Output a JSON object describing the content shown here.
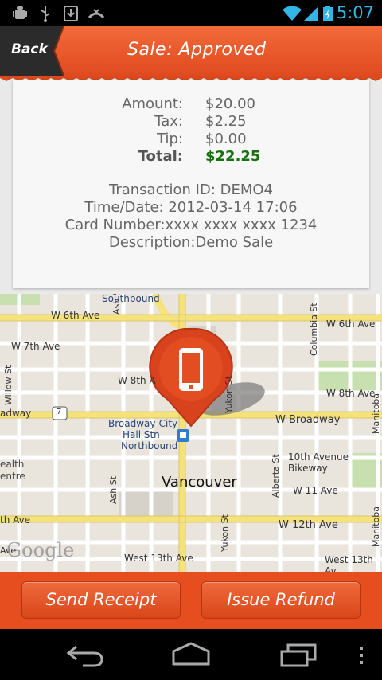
{
  "status_bar": {
    "time": "5:07",
    "icons": [
      "android-debug-icon",
      "usb-icon",
      "download-icon",
      "voicemail-icon",
      "wifi-icon",
      "signal-icon",
      "battery-charging-icon"
    ]
  },
  "header": {
    "back_label": "Back",
    "title": "Sale: Approved"
  },
  "receipt": {
    "amount_label": "Amount:",
    "amount_value": "$20.00",
    "tax_label": "Tax:",
    "tax_value": "$2.25",
    "tip_label": "Tip:",
    "tip_value": "$0.00",
    "total_label": "Total:",
    "total_value": "$22.25",
    "transaction_id": "Transaction ID: DEMO4",
    "time_date": "Time/Date: 2012-03-14 17:06",
    "card_number": "Card Number:xxxx xxxx xxxx 1234",
    "description": "Description:Demo Sale"
  },
  "map": {
    "city_label": "Vancouver",
    "attribution": "Google",
    "streets": [
      "Southbound",
      "W 6th Ave",
      "W 7th Ave",
      "W 8th A",
      "W 6th Ave",
      "W 8th Ave",
      "adway",
      "W Broadway",
      "10th Avenue Bikeway",
      "W 11 Ave",
      "W 12th Ave",
      "th Ave",
      "West 13th Ave",
      "West 13th Av",
      "Ash St",
      "Ash St",
      "Willow St",
      "Yukon St",
      "Yukon St",
      "Columbia St",
      "Alberta St",
      "Manitoba St",
      "Manitoba St",
      "Ave"
    ],
    "station_label_1": "Broadway-City",
    "station_label_2": "Hall Stn",
    "station_label_3": "Northbound",
    "poi_1": "ealth",
    "poi_2": "entre",
    "route_number": "7"
  },
  "actions": {
    "send_receipt": "Send Receipt",
    "issue_refund": "Issue Refund"
  },
  "colors": {
    "accent": "#e64e1f",
    "total": "#17710f"
  }
}
